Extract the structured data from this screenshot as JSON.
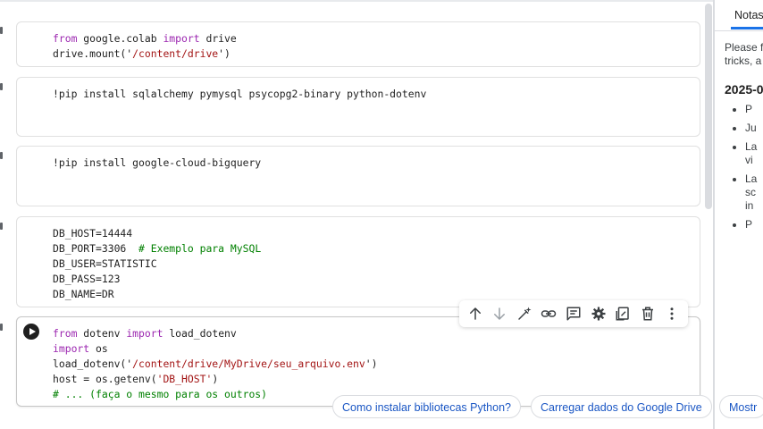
{
  "cells": [
    {
      "lines": [
        [
          {
            "t": "from",
            "c": "kw"
          },
          {
            "t": " google.colab "
          },
          {
            "t": "import",
            "c": "kw"
          },
          {
            "t": " drive"
          }
        ],
        [
          {
            "t": "drive.mount("
          },
          {
            "t": "'"
          },
          {
            "t": "/content/drive",
            "c": "str"
          },
          {
            "t": "'"
          },
          {
            "t": ")"
          }
        ]
      ]
    },
    {
      "lines": [
        [
          {
            "t": "!pip install sqlalchemy pymysql psycopg2-binary python-dotenv"
          }
        ]
      ]
    },
    {
      "lines": [
        [
          {
            "t": "!pip install google-cloud-bigquery"
          }
        ]
      ]
    },
    {
      "lines": [
        [
          {
            "t": "DB_HOST=14444"
          }
        ],
        [
          {
            "t": "DB_PORT=3306  "
          },
          {
            "t": "# Exemplo para MySQL",
            "c": "cm"
          }
        ],
        [
          {
            "t": "DB_USER=STATISTIC"
          }
        ],
        [
          {
            "t": "DB_PASS=123"
          }
        ],
        [
          {
            "t": "DB_NAME=DR"
          }
        ]
      ]
    },
    {
      "lines": [
        [
          {
            "t": "from",
            "c": "kw"
          },
          {
            "t": " dotenv "
          },
          {
            "t": "import",
            "c": "kw"
          },
          {
            "t": " load_dotenv"
          }
        ],
        [
          {
            "t": "import",
            "c": "kw"
          },
          {
            "t": " os"
          }
        ],
        [
          {
            "t": "load_dotenv("
          },
          {
            "t": "'"
          },
          {
            "t": "/content/drive/MyDrive/seu_arquivo.env",
            "c": "str"
          },
          {
            "t": "'"
          },
          {
            "t": ")"
          }
        ],
        [
          {
            "t": "host = os.getenv("
          },
          {
            "t": "'DB_HOST'",
            "c": "str"
          },
          {
            "t": ")"
          }
        ],
        [
          {
            "t": "# ... (faça o mesmo para os outros)",
            "c": "cm"
          }
        ]
      ]
    }
  ],
  "toolbar": {
    "buttons": [
      {
        "name": "move-cell-up-button",
        "icon": "arrow-up-icon"
      },
      {
        "name": "move-cell-down-button",
        "icon": "arrow-down-icon"
      },
      {
        "name": "generate-code-button",
        "icon": "magic-pen-icon"
      },
      {
        "name": "copy-link-button",
        "icon": "link-icon"
      },
      {
        "name": "add-comment-button",
        "icon": "comment-icon"
      },
      {
        "name": "cell-settings-button",
        "icon": "gear-icon"
      },
      {
        "name": "mirror-cell-button",
        "icon": "tab-icon"
      },
      {
        "name": "delete-cell-button",
        "icon": "trash-icon"
      },
      {
        "name": "more-options-button",
        "icon": "more-vertical-icon"
      }
    ]
  },
  "side_panel": {
    "tab_label": "Notas",
    "intro_line1": "Please f",
    "intro_line2": "tricks, a",
    "date_heading": "2025-0",
    "items": [
      "P",
      "Ju",
      "La",
      "vi",
      "La",
      "sc",
      "in",
      "P"
    ]
  },
  "suggestions": [
    "Como instalar bibliotecas Python?",
    "Carregar dados do Google Drive",
    "Mostr"
  ],
  "colors": {
    "keyword": "#9c27b0",
    "string": "#a31515",
    "comment": "#008000",
    "chip_text": "#1a56c4",
    "accent": "#1a73e8"
  }
}
